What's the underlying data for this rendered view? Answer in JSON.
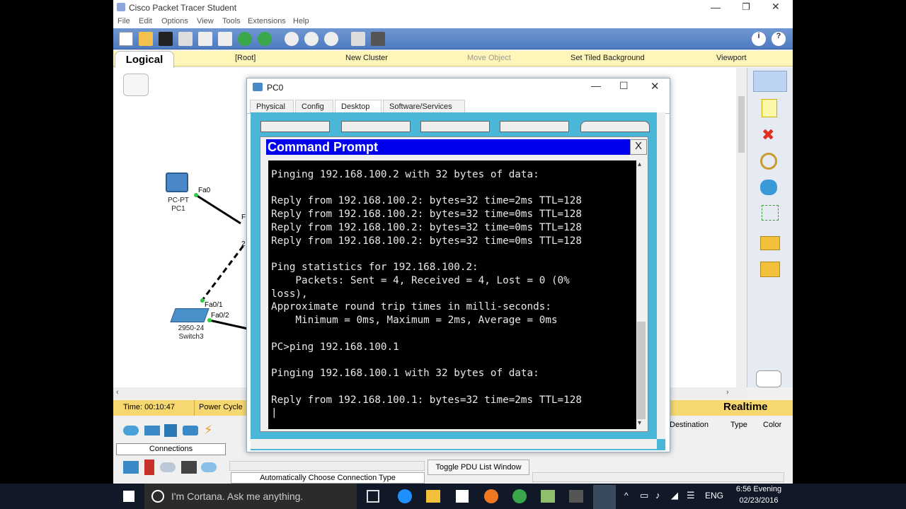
{
  "app": {
    "title": "Cisco Packet Tracer Student",
    "menu": [
      "File",
      "Edit",
      "Options",
      "View",
      "Tools",
      "Extensions",
      "Help"
    ],
    "tabbar": {
      "logical": "Logical",
      "root": "[Root]",
      "new_cluster": "New Cluster",
      "move_object": "Move Object",
      "set_tiled_bg": "Set Tiled Background",
      "viewport": "Viewport"
    }
  },
  "workspace": {
    "devices": {
      "pc1_type": "PC-PT",
      "pc1_name": "PC1",
      "pc1_port": "Fa0",
      "switch_port_partial": "F",
      "switch_num_partial": "2",
      "switch3_model": "2950-24",
      "switch3_name": "Switch3",
      "switch3_port1": "Fa0/1",
      "switch3_port2": "Fa0/2"
    }
  },
  "bottom": {
    "time": "Time: 00:10:47",
    "power_cycle": "Power Cycle",
    "realtime": "Realtime",
    "connections": "Connections",
    "auto_conn": "Automatically Choose Connection Type",
    "toggle_pdu": "Toggle PDU List Window",
    "pdu_cols": [
      "Destination",
      "Type",
      "Color"
    ]
  },
  "pc_window": {
    "title": "PC0",
    "tabs": [
      "Physical",
      "Config",
      "Desktop",
      "Software/Services"
    ],
    "active_tab": "Desktop"
  },
  "command_prompt": {
    "title": "Command Prompt",
    "close": "X",
    "lines": [
      "",
      "Pinging 192.168.100.2 with 32 bytes of data:",
      "",
      "Reply from 192.168.100.2: bytes=32 time=2ms TTL=128",
      "Reply from 192.168.100.2: bytes=32 time=0ms TTL=128",
      "Reply from 192.168.100.2: bytes=32 time=0ms TTL=128",
      "Reply from 192.168.100.2: bytes=32 time=0ms TTL=128",
      "",
      "Ping statistics for 192.168.100.2:",
      "    Packets: Sent = 4, Received = 4, Lost = 0 (0%",
      "loss),",
      "Approximate round trip times in milli-seconds:",
      "    Minimum = 0ms, Maximum = 2ms, Average = 0ms",
      "",
      "PC>ping 192.168.100.1",
      "",
      "Pinging 192.168.100.1 with 32 bytes of data:",
      "",
      "Reply from 192.168.100.1: bytes=32 time=2ms TTL=128",
      "|"
    ]
  },
  "taskbar": {
    "cortana": "I'm Cortana. Ask me anything.",
    "lang": "ENG",
    "time": "6:56 Evening",
    "date": "02/23/2016"
  }
}
